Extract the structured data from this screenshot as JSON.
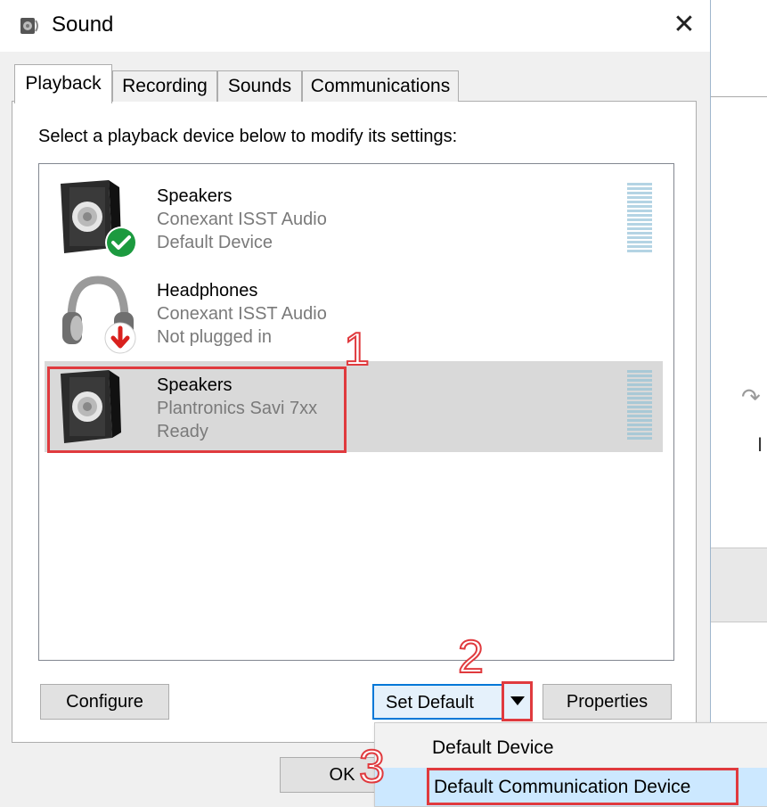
{
  "window": {
    "title": "Sound",
    "close_glyph": "✕"
  },
  "tabs": [
    {
      "label": "Playback",
      "active": true
    },
    {
      "label": "Recording",
      "active": false
    },
    {
      "label": "Sounds",
      "active": false
    },
    {
      "label": "Communications",
      "active": false
    }
  ],
  "instruction": "Select a playback device below to modify its settings:",
  "devices": [
    {
      "name": "Speakers",
      "driver": "Conexant ISST Audio",
      "status": "Default Device",
      "icon": "speaker-icon",
      "badge": "green-check-badge"
    },
    {
      "name": "Headphones",
      "driver": "Conexant ISST Audio",
      "status": "Not plugged in",
      "icon": "headphones-icon",
      "badge": "red-down-arrow-badge"
    },
    {
      "name": "Speakers",
      "driver": "Plantronics Savi 7xx",
      "status": "Ready",
      "icon": "speaker-icon",
      "selected": true
    }
  ],
  "buttons": {
    "configure": "Configure",
    "set_default": "Set Default",
    "properties": "Properties",
    "ok": "OK"
  },
  "dropdown_menu": [
    {
      "label": "Default Device"
    },
    {
      "label": "Default Communication Device",
      "highlighted": true
    }
  ],
  "annotations": {
    "step1": "1",
    "step2": "2",
    "step3": "3"
  },
  "colors": {
    "highlight_box": "#e03a3e",
    "selection": "#d9d9d9",
    "menu_highlight": "#cce8ff",
    "accent_border": "#0078d7"
  }
}
